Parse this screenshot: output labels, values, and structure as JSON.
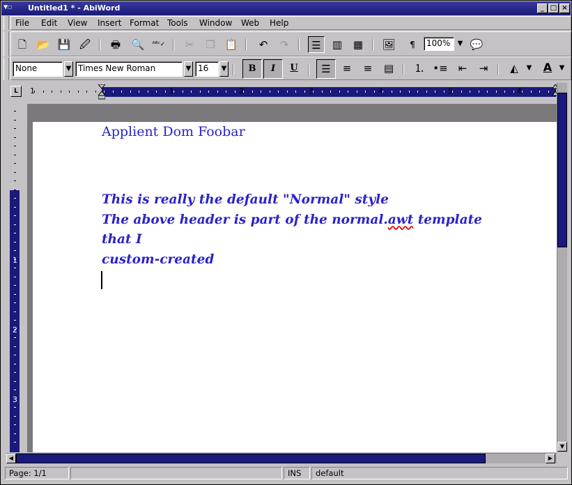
{
  "window": {
    "title": "Untitled1 * - AbiWord",
    "buttons": [
      "_",
      "□",
      "×"
    ]
  },
  "menu": [
    "File",
    "Edit",
    "View",
    "Insert",
    "Format",
    "Tools",
    "Window",
    "Web",
    "Help"
  ],
  "toolbar": {
    "zoom": "100%"
  },
  "format_toolbar": {
    "style": "None",
    "font": "Times New Roman",
    "size": "16",
    "bold": "B",
    "italic": "I",
    "underline": "U",
    "text_color_label": "A"
  },
  "ruler": {
    "h_numbers": [
      "1",
      "1",
      "2",
      "3",
      "4",
      "5",
      "6"
    ],
    "v_numbers": [
      "1",
      "2",
      "3"
    ],
    "corner": "L"
  },
  "document": {
    "header": "Applient Dom Foobar",
    "line1": "This is really the default \"Normal\" style",
    "line2_pre": "The above header is part of the normal.",
    "line2_squig": "awt",
    "line2_post": " template that I",
    "line3": "custom-created"
  },
  "status": {
    "page": "Page: 1/1",
    "mode": "INS",
    "style": "default"
  }
}
